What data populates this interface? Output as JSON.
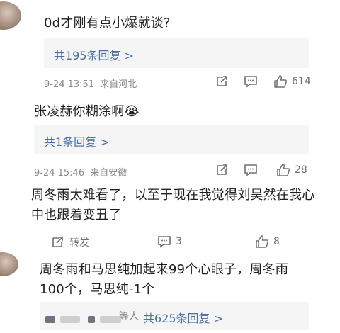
{
  "comments": [
    {
      "text": "0d才刚有点小爆就谈?",
      "reply_summary": "共195条回复 >",
      "time": "9-24 13:51",
      "location": "来自河北",
      "likes": "614"
    },
    {
      "text": "张凌赫你糊涂啊😭",
      "reply_summary": "共1条回复 >",
      "time": "9-24 15:46",
      "location": "来自安徽",
      "likes": "28"
    },
    {
      "text_line1": "周冬雨太难看了，以至于现在我觉得刘昊然在我心",
      "text_line2": "中也跟着变丑了",
      "repost_label": "转发",
      "comments_count": "3",
      "likes": "8"
    },
    {
      "text_line1": "周冬雨和马思纯加起来99个心眼子，周冬雨",
      "text_line2": "100个，马思纯-1个",
      "reply_name_fragment": "等人",
      "reply_summary": "共625条回复 >"
    }
  ]
}
